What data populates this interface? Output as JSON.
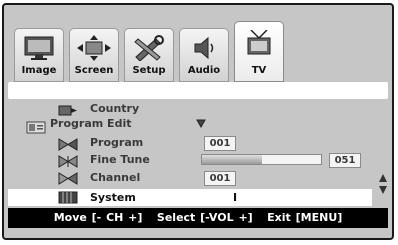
{
  "tabs": [
    {
      "label": "Image",
      "icon": "monitor-icon"
    },
    {
      "label": "Screen",
      "icon": "resize-arrows-icon"
    },
    {
      "label": "Setup",
      "icon": "tools-icon"
    },
    {
      "label": "Audio",
      "icon": "speaker-icon"
    },
    {
      "label": "TV",
      "icon": "tv-antenna-icon",
      "active": true
    }
  ],
  "menu": {
    "country": {
      "label": "Country"
    },
    "program_edit": {
      "label": "Program Edit"
    },
    "program": {
      "label": "Program",
      "value": "001"
    },
    "fine_tune": {
      "label": "Fine Tune",
      "value": "051",
      "level_fraction": 0.5
    },
    "channel": {
      "label": "Channel",
      "value": "001"
    },
    "system": {
      "label": "System",
      "value": "I"
    }
  },
  "footer": {
    "hint": "Move [- CH +]   Select [-VOL +]   Exit [MENU]"
  },
  "colors": {
    "panel": "#c6c6c6",
    "highlight": "#ffffff",
    "hint_bar": "#000000"
  }
}
